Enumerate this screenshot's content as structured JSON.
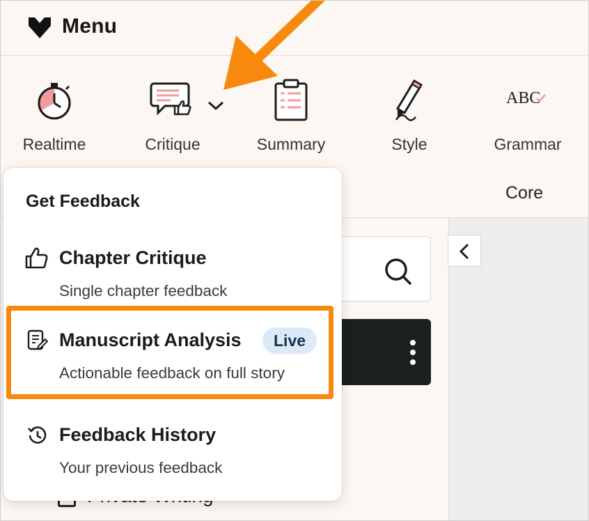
{
  "menu": {
    "title": "Menu"
  },
  "toolbar": {
    "tools": [
      {
        "label": "Realtime",
        "icon": "stopwatch-icon"
      },
      {
        "label": "Critique",
        "icon": "critique-icon",
        "has_dropdown": true
      },
      {
        "label": "Summary",
        "icon": "clipboard-icon"
      },
      {
        "label": "Style",
        "icon": "pencil-icon"
      },
      {
        "label": "Grammar",
        "icon": "abc-check-icon",
        "icon_text": "ABC"
      }
    ],
    "section_label": "Core"
  },
  "background": {
    "sidebar_item": "Private Writing"
  },
  "popup": {
    "heading": "Get Feedback",
    "items": [
      {
        "title": "Chapter Critique",
        "subtitle": "Single chapter feedback",
        "icon": "thumbs-up-icon"
      },
      {
        "title": "Manuscript Analysis",
        "subtitle": "Actionable feedback on full story",
        "icon": "document-edit-icon",
        "badge": "Live"
      },
      {
        "title": "Feedback History",
        "subtitle": "Your previous feedback",
        "icon": "history-icon"
      }
    ]
  },
  "colors": {
    "accent_orange": "#f7890d",
    "icon_pink": "#f29b9b",
    "badge_bg": "#dbeaf6",
    "dark_row": "#1b1f1e"
  }
}
